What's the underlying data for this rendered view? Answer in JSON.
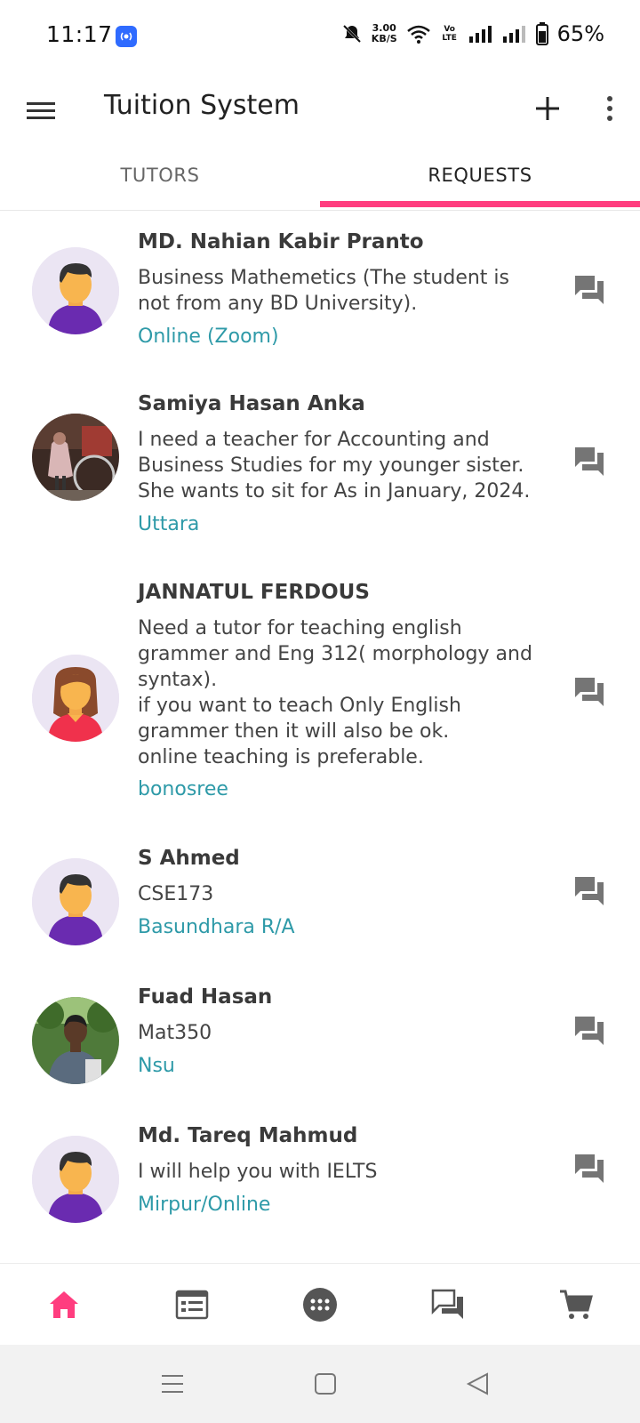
{
  "status_bar": {
    "time": "11:17",
    "net_speed_value": "3.00",
    "net_speed_unit": "KB/S",
    "volte": "Vo LTE",
    "battery": "65%"
  },
  "app_bar": {
    "title": "Tuition System"
  },
  "tabs": [
    {
      "label": "TUTORS",
      "selected": false
    },
    {
      "label": "REQUESTS",
      "selected": true
    }
  ],
  "accent_color": "#ff3d7f",
  "location_color": "#2e9aa8",
  "requests": [
    {
      "name": "MD. Nahian Kabir Pranto",
      "description": "Business Mathemetics (The student is not from any BD University).",
      "location": "Online (Zoom)",
      "avatar": "default-male-avatar"
    },
    {
      "name": "Samiya Hasan Anka",
      "description": "I need a teacher for Accounting and Business Studies for my younger sister. She wants to sit for As in January, 2024.",
      "location": "Uttara",
      "avatar": "photo-avatar"
    },
    {
      "name": "JANNATUL FERDOUS",
      "description": "Need a tutor for teaching english grammer and Eng 312( morphology and syntax).\nif you want to teach Only English grammer then it will also be ok.\nonline teaching is preferable.",
      "location": "bonosree",
      "avatar": "default-female-avatar"
    },
    {
      "name": "S Ahmed",
      "description": "CSE173",
      "location": "Basundhara R/A",
      "avatar": "default-male-avatar"
    },
    {
      "name": "Fuad Hasan",
      "description": "Mat350",
      "location": "Nsu",
      "avatar": "photo-avatar"
    },
    {
      "name": "Md. Tareq Mahmud",
      "description": "I will help you with IELTS",
      "location": "Mirpur/Online",
      "avatar": "default-male-avatar"
    }
  ],
  "bottom_nav": [
    "home-icon",
    "list-icon",
    "more-dots-icon",
    "chat-icon",
    "cart-icon"
  ]
}
